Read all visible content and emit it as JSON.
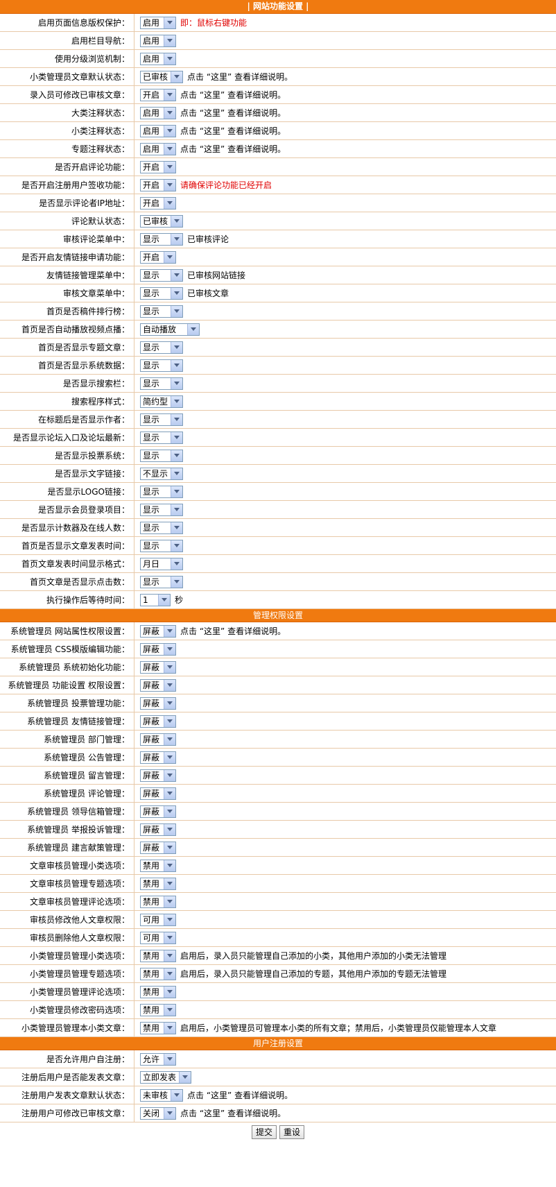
{
  "sections": [
    {
      "title": "| 网站功能设置 |",
      "rows": [
        {
          "label": "启用页面信息版权保护：",
          "value": "启用",
          "note": "即：鼠标右键功能",
          "note_red": true,
          "w": 52
        },
        {
          "label": "启用栏目导航：",
          "value": "启用",
          "note": "",
          "w": 52
        },
        {
          "label": "使用分级浏览机制：",
          "value": "启用",
          "note": "",
          "w": 52
        },
        {
          "label": "小类管理员文章默认状态：",
          "value": "已审核",
          "note": "点击 “这里” 查看详细说明。",
          "w": 62
        },
        {
          "label": "录入员可修改已审核文章：",
          "value": "开启",
          "note": "点击 “这里” 查看详细说明。",
          "w": 52
        },
        {
          "label": "大类注释状态：",
          "value": "启用",
          "note": "点击 “这里” 查看详细说明。",
          "w": 52
        },
        {
          "label": "小类注释状态：",
          "value": "启用",
          "note": "点击 “这里” 查看详细说明。",
          "w": 52
        },
        {
          "label": "专题注释状态：",
          "value": "启用",
          "note": "点击 “这里” 查看详细说明。",
          "w": 52
        },
        {
          "label": "是否开启评论功能：",
          "value": "开启",
          "note": "",
          "w": 52
        },
        {
          "label": "是否开启注册用户签收功能：",
          "value": "开启",
          "note": "请确保评论功能已经开启",
          "note_red": true,
          "w": 52
        },
        {
          "label": "是否显示评论者IP地址：",
          "value": "开启",
          "note": "",
          "w": 52
        },
        {
          "label": "评论默认状态：",
          "value": "已审核",
          "note": "",
          "w": 62
        },
        {
          "label": "审核评论菜单中：",
          "value": "显示",
          "note": "已审核评论",
          "w": 62
        },
        {
          "label": "是否开启友情链接申请功能：",
          "value": "开启",
          "note": "",
          "w": 52
        },
        {
          "label": "友情链接管理菜单中：",
          "value": "显示",
          "note": "已审核网站链接",
          "w": 62
        },
        {
          "label": "审核文章菜单中：",
          "value": "显示",
          "note": "已审核文章",
          "w": 62
        },
        {
          "label": "首页是否稿件排行榜：",
          "value": "显示",
          "note": "",
          "w": 62
        },
        {
          "label": "首页是否自动播放视频点播：",
          "value": "自动播放",
          "note": "",
          "w": 86
        },
        {
          "label": "首页是否显示专题文章：",
          "value": "显示",
          "note": "",
          "w": 62
        },
        {
          "label": "首页是否显示系统数据：",
          "value": "显示",
          "note": "",
          "w": 62
        },
        {
          "label": "是否显示搜索栏：",
          "value": "显示",
          "note": "",
          "w": 62
        },
        {
          "label": "搜索程序样式：",
          "value": "简约型",
          "note": "",
          "w": 62
        },
        {
          "label": "在标题后是否显示作者：",
          "value": "显示",
          "note": "",
          "w": 62
        },
        {
          "label": "是否显示论坛入口及论坛最新：",
          "value": "显示",
          "note": "",
          "w": 62
        },
        {
          "label": "是否显示投票系统：",
          "value": "显示",
          "note": "",
          "w": 62
        },
        {
          "label": "是否显示文字链接：",
          "value": "不显示",
          "note": "",
          "w": 62
        },
        {
          "label": "是否显示LOGO链接：",
          "value": "显示",
          "note": "",
          "w": 62
        },
        {
          "label": "是否显示会员登录项目：",
          "value": "显示",
          "note": "",
          "w": 62
        },
        {
          "label": "是否显示计数器及在线人数：",
          "value": "显示",
          "note": "",
          "w": 62
        },
        {
          "label": "首页是否显示文章发表时间：",
          "value": "显示",
          "note": "",
          "w": 62
        },
        {
          "label": "首页文章发表时间显示格式：",
          "value": "月日",
          "note": "",
          "w": 62
        },
        {
          "label": "首页文章是否显示点击数：",
          "value": "显示",
          "note": "",
          "w": 62
        },
        {
          "label": "执行操作后等待时间：",
          "value": "1",
          "note": "秒",
          "w": 44
        }
      ]
    },
    {
      "title": "管理权限设置",
      "rows": [
        {
          "label": "系统管理员 网站属性权限设置：",
          "value": "屏蔽",
          "note": "点击 “这里” 查看详细说明。",
          "w": 52
        },
        {
          "label": "系统管理员 CSS模版编辑功能：",
          "value": "屏蔽",
          "note": "",
          "w": 52
        },
        {
          "label": "系统管理员 系统初始化功能：",
          "value": "屏蔽",
          "note": "",
          "w": 52
        },
        {
          "label": "系统管理员 功能设置 权限设置：",
          "value": "屏蔽",
          "note": "",
          "w": 52
        },
        {
          "label": "系统管理员 投票管理功能：",
          "value": "屏蔽",
          "note": "",
          "w": 52
        },
        {
          "label": "系统管理员 友情链接管理：",
          "value": "屏蔽",
          "note": "",
          "w": 52
        },
        {
          "label": "系统管理员 部门管理：",
          "value": "屏蔽",
          "note": "",
          "w": 52
        },
        {
          "label": "系统管理员 公告管理：",
          "value": "屏蔽",
          "note": "",
          "w": 52
        },
        {
          "label": "系统管理员 留言管理：",
          "value": "屏蔽",
          "note": "",
          "w": 52
        },
        {
          "label": "系统管理员 评论管理：",
          "value": "屏蔽",
          "note": "",
          "w": 52
        },
        {
          "label": "系统管理员 领导信箱管理：",
          "value": "屏蔽",
          "note": "",
          "w": 52
        },
        {
          "label": "系统管理员 举报投诉管理：",
          "value": "屏蔽",
          "note": "",
          "w": 52
        },
        {
          "label": "系统管理员 建言献策管理：",
          "value": "屏蔽",
          "note": "",
          "w": 52
        },
        {
          "label": "文章审核员管理小类选项：",
          "value": "禁用",
          "note": "",
          "w": 52
        },
        {
          "label": "文章审核员管理专题选项：",
          "value": "禁用",
          "note": "",
          "w": 52
        },
        {
          "label": "文章审核员管理评论选项：",
          "value": "禁用",
          "note": "",
          "w": 52
        },
        {
          "label": "审核员修改他人文章权限：",
          "value": "可用",
          "note": "",
          "w": 52
        },
        {
          "label": "审核员删除他人文章权限：",
          "value": "可用",
          "note": "",
          "w": 52
        },
        {
          "label": "小类管理员管理小类选项：",
          "value": "禁用",
          "note": "启用后，录入员只能管理自己添加的小类，其他用户添加的小类无法管理",
          "w": 52
        },
        {
          "label": "小类管理员管理专题选项：",
          "value": "禁用",
          "note": "启用后，录入员只能管理自己添加的专题，其他用户添加的专题无法管理",
          "w": 52
        },
        {
          "label": "小类管理员管理评论选项：",
          "value": "禁用",
          "note": "",
          "w": 52
        },
        {
          "label": "小类管理员修改密码选项：",
          "value": "禁用",
          "note": "",
          "w": 52
        },
        {
          "label": "小类管理员管理本小类文章：",
          "value": "禁用",
          "note": "启用后，小类管理员可管理本小类的所有文章；禁用后，小类管理员仅能管理本人文章",
          "w": 52
        }
      ]
    },
    {
      "title": "用户注册设置",
      "rows": [
        {
          "label": "是否允许用户自注册：",
          "value": "允许",
          "note": "",
          "w": 52
        },
        {
          "label": "注册后用户是否能发表文章：",
          "value": "立即发表",
          "note": "",
          "w": 74
        },
        {
          "label": "注册用户发表文章默认状态：",
          "value": "未审核",
          "note": "点击 “这里” 查看详细说明。",
          "w": 62
        },
        {
          "label": "注册用户可修改已审核文章：",
          "value": "关闭",
          "note": "点击 “这里” 查看详细说明。",
          "w": 52
        }
      ]
    }
  ],
  "buttons": {
    "submit": "提交",
    "reset": "重设"
  },
  "colors": {
    "header": "#f07a10",
    "border": "#e8c9a8",
    "red_note": "#e00000"
  }
}
